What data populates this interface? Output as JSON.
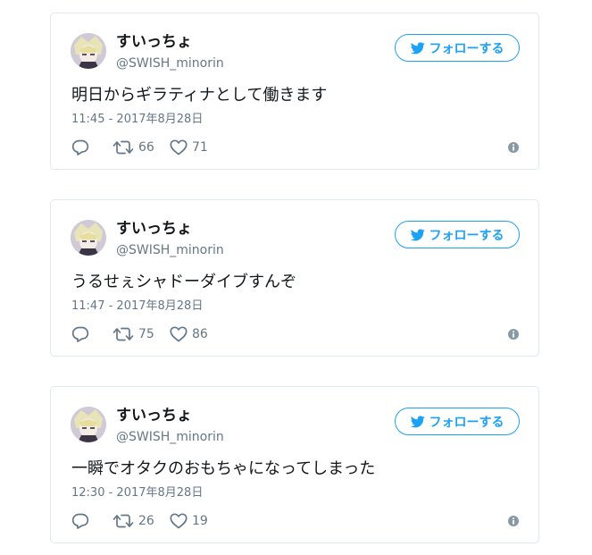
{
  "colors": {
    "accent": "#1da1f2",
    "secondary_text": "#657786",
    "border": "#e1e8ed",
    "primary_text": "#14171a"
  },
  "tweets": [
    {
      "name": "すいっちょ",
      "handle": "@SWISH_minorin",
      "follow_label": "フォローする",
      "text": "明日からギラティナとして働きます",
      "timestamp": "11:45 - 2017年8月28日",
      "retweets": "66",
      "likes": "71"
    },
    {
      "name": "すいっちょ",
      "handle": "@SWISH_minorin",
      "follow_label": "フォローする",
      "text": "うるせぇシャドーダイブすんぞ",
      "timestamp": "11:47 - 2017年8月28日",
      "retweets": "75",
      "likes": "86"
    },
    {
      "name": "すいっちょ",
      "handle": "@SWISH_minorin",
      "follow_label": "フォローする",
      "text": "一瞬でオタクのおもちゃになってしまった",
      "timestamp": "12:30 - 2017年8月28日",
      "retweets": "26",
      "likes": "19"
    }
  ],
  "icons": {
    "bird": "twitter-bird-icon",
    "reply": "reply-icon",
    "retweet": "retweet-icon",
    "like": "heart-icon",
    "info": "info-icon"
  }
}
